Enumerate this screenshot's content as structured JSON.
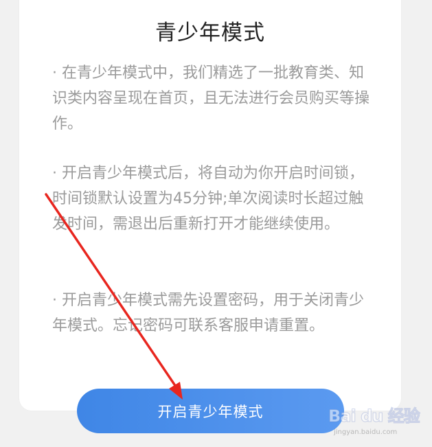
{
  "dialog": {
    "title": "青少年模式",
    "paragraphs": [
      "· 在青少年模式中，我们精选了一批教育类、知识类内容呈现在首页，且无法进行会员购买等操作。",
      "· 开启青少年模式后，将自动为你开启时间锁，时间锁默认设置为45分钟;单次阅读时长超过触发时间，需退出后重新打开才能继续使用。",
      "· 开启青少年模式需先设置密码，用于关闭青少年模式。忘记密码可联系客服申请重置。"
    ],
    "enable_button_label": "开启青少年模式"
  },
  "watermark": {
    "logo_text": "Bai du 经验",
    "url_text": "jingyan.baidu.com"
  },
  "colors": {
    "button": "#4a8fe9",
    "annotation_arrow": "#e8261f",
    "body_text": "#9a9a9a",
    "title_text": "#222222"
  },
  "icons": {
    "annotation": "red-arrow-icon"
  }
}
